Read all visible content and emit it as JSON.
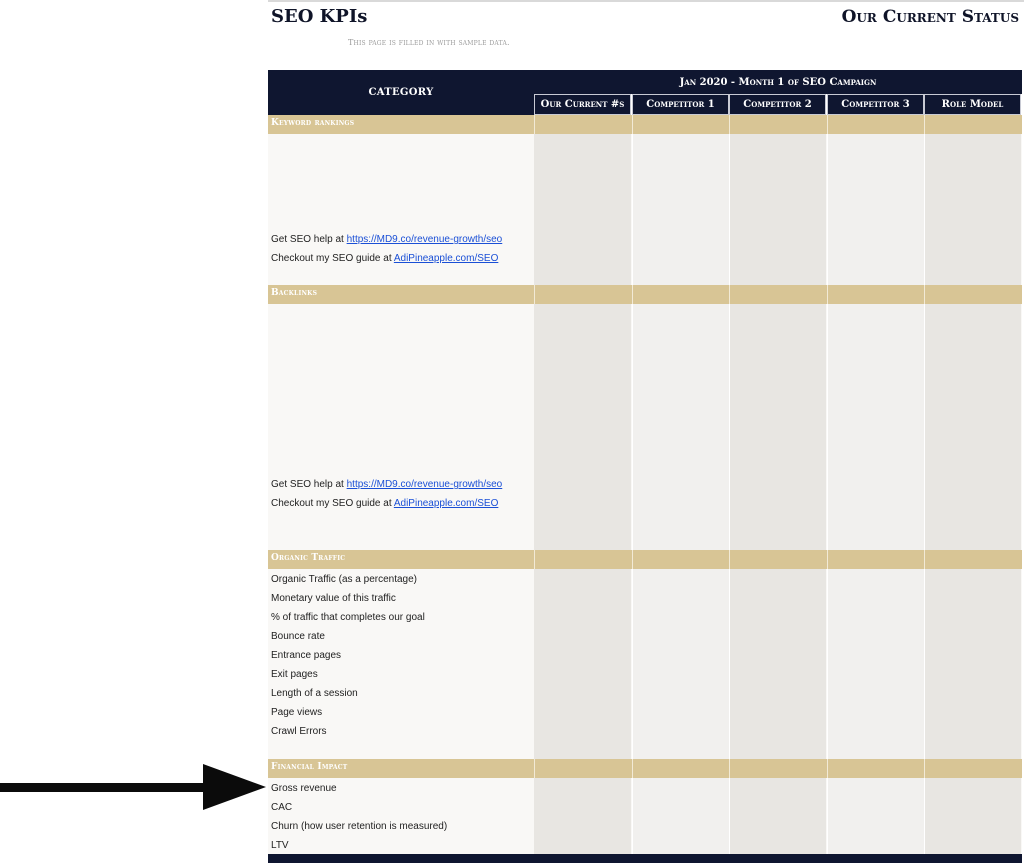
{
  "header": {
    "title": "SEO KPIs",
    "status_title": "Our Current Status",
    "note": "This page is filled in with sample data."
  },
  "table": {
    "category_header": "CATEGORY",
    "month_header": "Jan 2020 - Month 1 of SEO Campaign",
    "columns": [
      "Our Current #s",
      "Competitor 1",
      "Competitor 2",
      "Competitor 3",
      "Role Model"
    ],
    "sections": {
      "keyword": {
        "label": "Keyword rankings",
        "help_prefix": "Get SEO help at ",
        "help_link": "https://MD9.co/revenue-growth/seo",
        "guide_prefix": "Checkout my SEO guide at ",
        "guide_link": "AdiPineapple.com/SEO"
      },
      "backlinks": {
        "label": "Backlinks",
        "help_prefix": "Get SEO help at ",
        "help_link": "https://MD9.co/revenue-growth/seo",
        "guide_prefix": "Checkout my SEO guide at ",
        "guide_link": "AdiPineapple.com/SEO"
      },
      "organic": {
        "label": "Organic Traffic",
        "rows": [
          "Organic Traffic (as a percentage)",
          "Monetary value of this traffic",
          "% of traffic that completes our goal",
          "Bounce rate",
          "Entrance pages",
          "Exit pages",
          "Length of a session",
          "Page views",
          "Crawl Errors"
        ]
      },
      "financial": {
        "label": "Financial Impact",
        "rows": [
          "Gross revenue",
          "CAC",
          "Churn (how user retention is measured)",
          "LTV"
        ]
      }
    }
  },
  "colors": {
    "header_navy": "#0f1630",
    "section_gold": "#d8c595",
    "link_blue": "#1a4fd6"
  },
  "icons": {
    "arrow": "arrow-right-icon"
  }
}
